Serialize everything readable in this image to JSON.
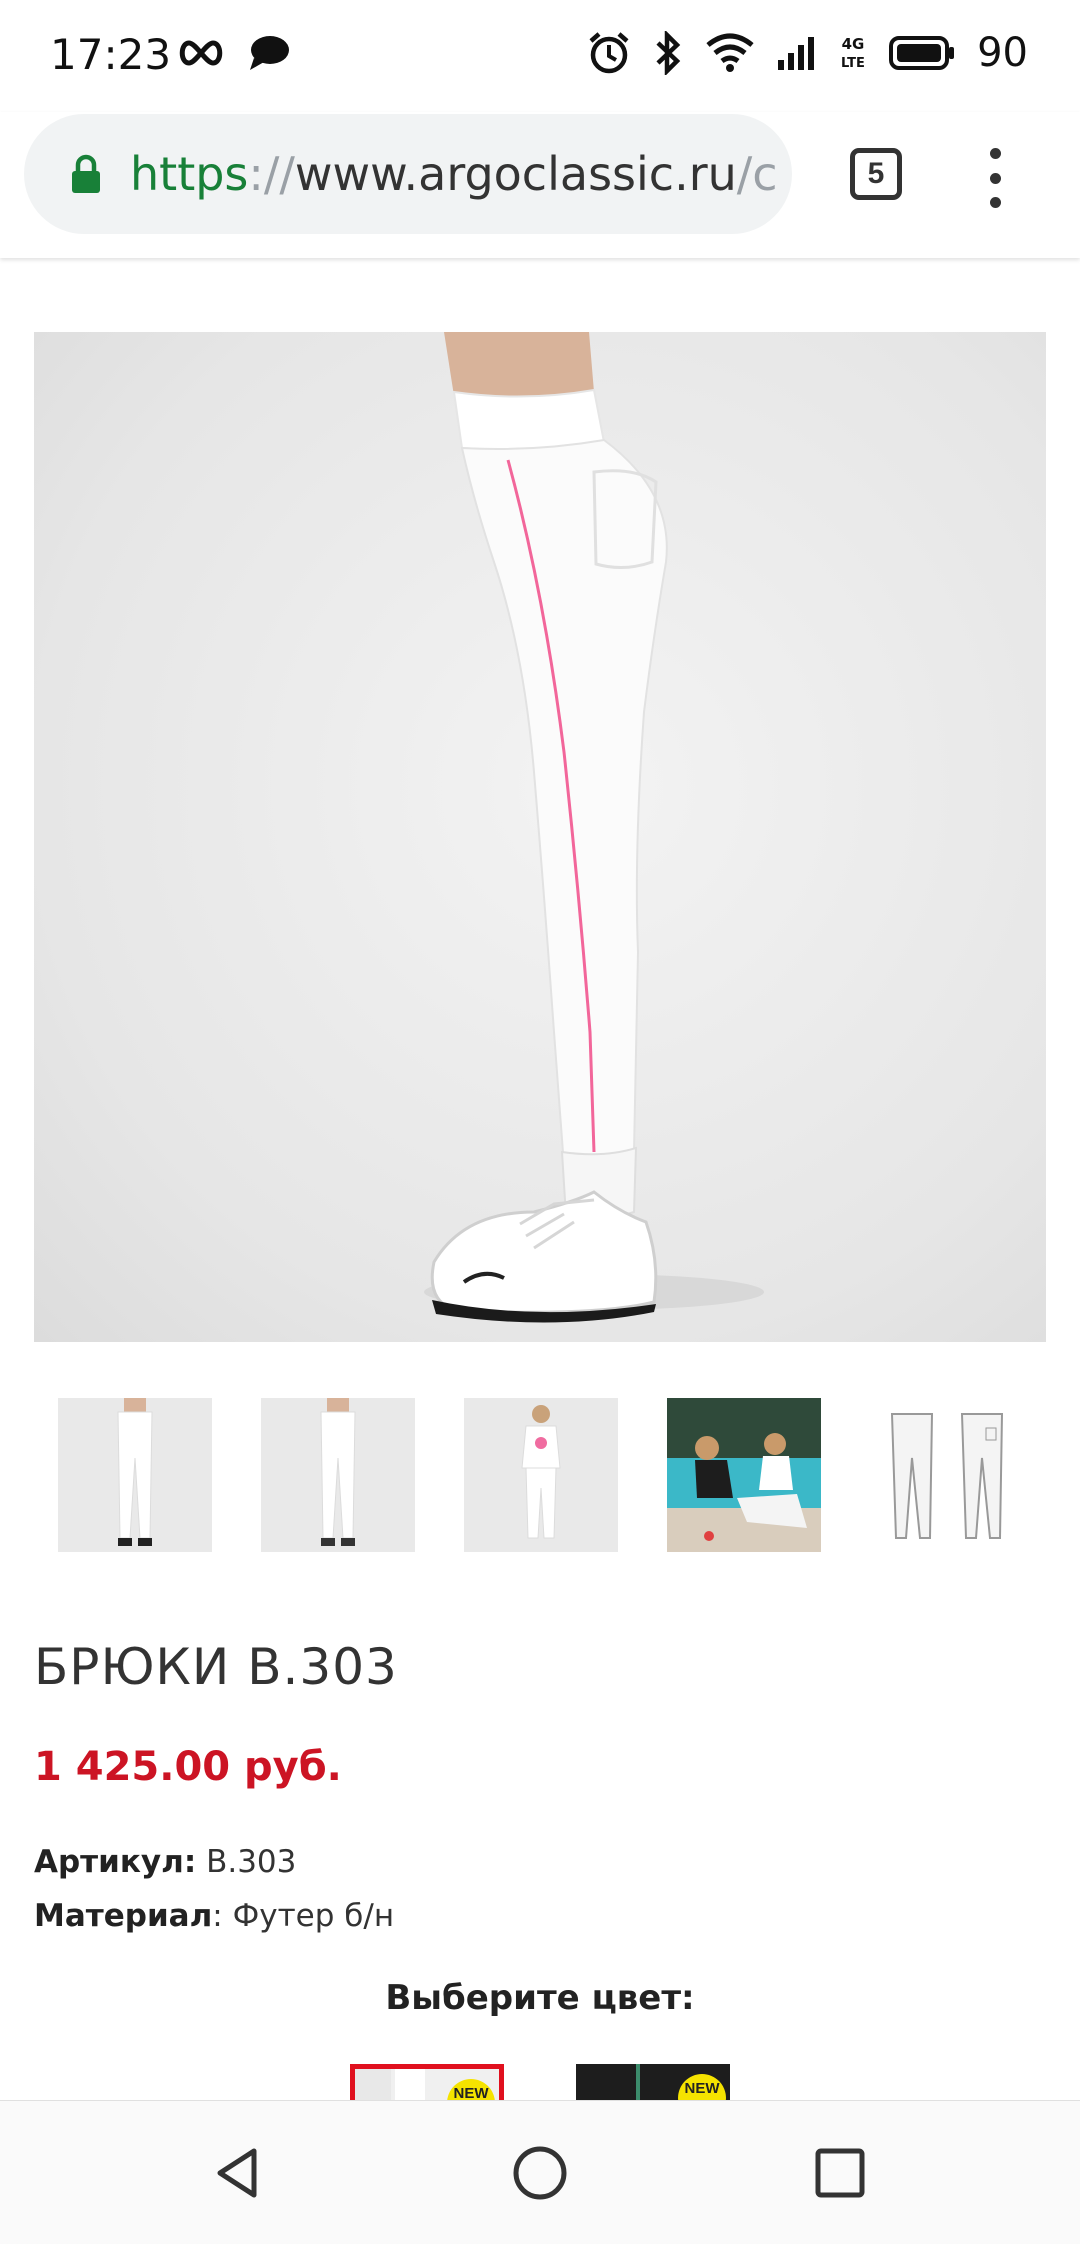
{
  "status_bar": {
    "time": "17:23",
    "battery": "90",
    "network": "4G LTE"
  },
  "browser": {
    "url_scheme": "https",
    "url_separator": "://",
    "url_host": "www.argoclassic.ru",
    "url_path": "/c",
    "tab_count": "5"
  },
  "product": {
    "title": "БРЮКИ B.303",
    "price": "1 425.00 руб.",
    "sku_label": "Артикул:",
    "sku_value": " B.303",
    "material_label": "Материал",
    "material_value": ": Футер б/н",
    "color_heading": "Выберите цвет:",
    "swatches": [
      {
        "badge": "NEW",
        "selected": true
      },
      {
        "badge": "NEW",
        "selected": false
      }
    ]
  },
  "colors": {
    "price": "#cc1424",
    "url_scheme": "#188038",
    "selected_border": "#e0101e",
    "badge": "#f5e300"
  }
}
